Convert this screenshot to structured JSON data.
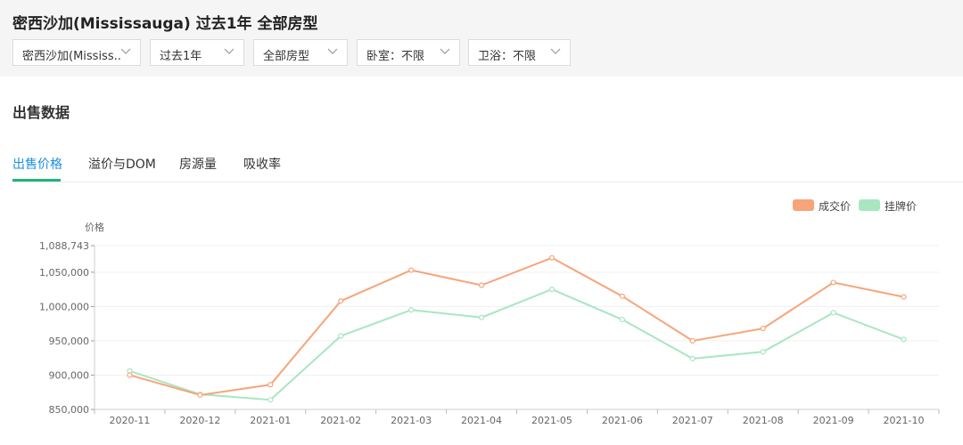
{
  "header": {
    "title": "密西沙加(Mississauga) 过去1年 全部房型",
    "filters": [
      {
        "label": "密西沙加(Mississ..."
      },
      {
        "label": "过去1年"
      },
      {
        "label": "全部房型"
      },
      {
        "label": "卧室：不限"
      },
      {
        "label": "卫浴：不限"
      }
    ]
  },
  "section_title": "出售数据",
  "tabs": [
    {
      "label": "出售价格",
      "active": true
    },
    {
      "label": "溢价与DOM",
      "active": false
    },
    {
      "label": "房源量",
      "active": false
    },
    {
      "label": "吸收率",
      "active": false
    }
  ],
  "colors": {
    "accent_tab": "#1a8fe0",
    "tab_underline": "#1fb57a",
    "sold_series": "#f7a47a",
    "list_series": "#a8e6c2"
  },
  "chart_data": {
    "type": "line",
    "ylabel": "价格",
    "xlabel": "",
    "categories": [
      "2020-11",
      "2020-12",
      "2021-01",
      "2021-02",
      "2021-03",
      "2021-04",
      "2021-05",
      "2021-06",
      "2021-07",
      "2021-08",
      "2021-09",
      "2021-10"
    ],
    "series": [
      {
        "name": "成交价",
        "values": [
          900000,
          871000,
          886000,
          1008000,
          1053000,
          1031000,
          1071000,
          1015000,
          950000,
          968000,
          1035000,
          1014000
        ]
      },
      {
        "name": "挂牌价",
        "values": [
          906000,
          872000,
          864000,
          957000,
          995000,
          984000,
          1025000,
          981000,
          924000,
          934000,
          991000,
          952000
        ]
      }
    ],
    "ylim": [
      850000,
      1088743
    ],
    "yticks": [
      "850,000",
      "900,000",
      "950,000",
      "1,000,000",
      "1,050,000",
      "1,088,743"
    ],
    "ytick_values": [
      850000,
      900000,
      950000,
      1000000,
      1050000,
      1088743
    ],
    "legend_position": "top-right",
    "grid": true
  }
}
